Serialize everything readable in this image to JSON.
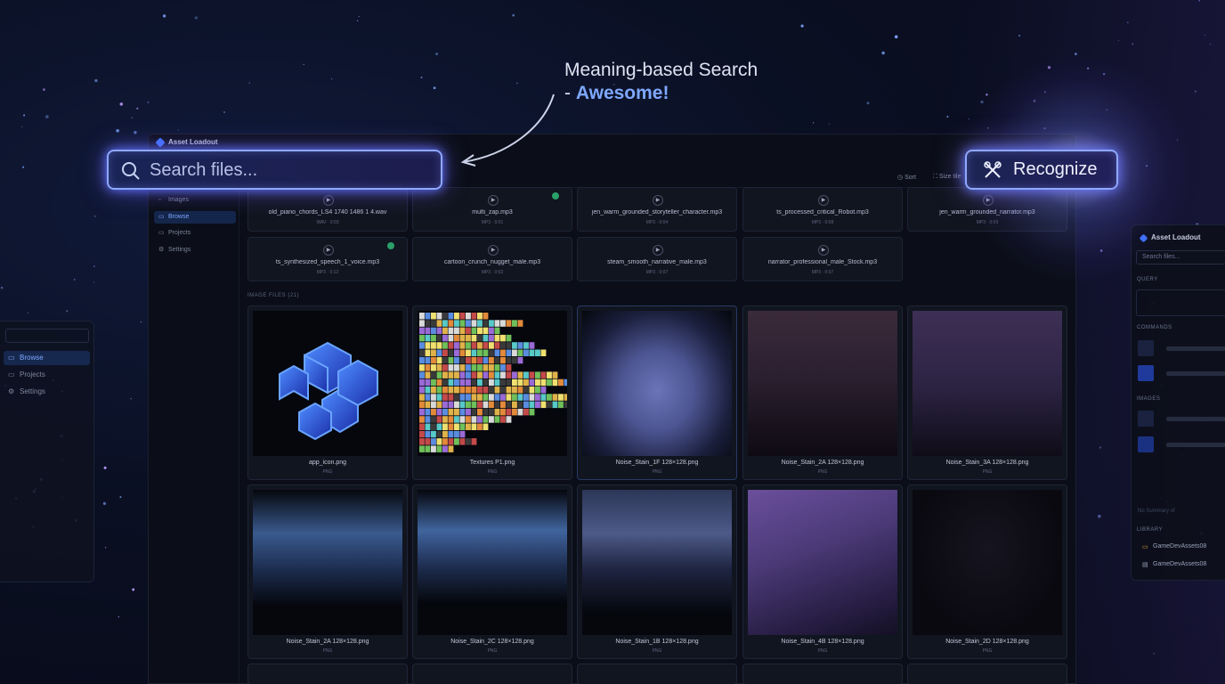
{
  "headline": {
    "line1": "Meaning-based Search",
    "prefix": "- ",
    "accent": "Awesome!"
  },
  "search": {
    "placeholder": "Search files..."
  },
  "recognize": {
    "label": "Recognize"
  },
  "window": {
    "title": "Asset Loadout",
    "toolbar": {
      "sort_label": "Sort",
      "view_label": "Size tile"
    }
  },
  "sidebar": {
    "items": [
      {
        "label": "Images"
      },
      {
        "label": "Browse"
      },
      {
        "label": "Projects"
      },
      {
        "label": "Settings"
      }
    ]
  },
  "back_window": {
    "items": [
      {
        "label": "Browse"
      },
      {
        "label": "Projects"
      },
      {
        "label": "Settings"
      }
    ]
  },
  "audio_files": [
    {
      "name": "old_piano_chords_LS4 1740 1486 1 4.wav",
      "meta": "WAV · 0:03"
    },
    {
      "name": "multi_zap.mp3",
      "meta": "MP3 · 0:01"
    },
    {
      "name": "jen_warm_grounded_storyteller_character.mp3",
      "meta": "MP3 · 0:04"
    },
    {
      "name": "ts_processed_critical_Robot.mp3",
      "meta": "MP3 · 0:08"
    },
    {
      "name": "jen_warm_grounded_narrator.mp3",
      "meta": "MP3 · 0:03"
    },
    {
      "name": "ts_synthesized_speech_1_voice.mp3",
      "meta": "MP3 · 0:12"
    },
    {
      "name": "cartoon_crunch_nugget_male.mp3",
      "meta": "MP3 · 0:02"
    },
    {
      "name": "steam_smooth_narrative_male.mp3",
      "meta": "MP3 · 0:07"
    },
    {
      "name": "narrator_professional_male_Stock.mp3",
      "meta": "MP3 · 0:07"
    }
  ],
  "section_label": "IMAGE FILES (21)",
  "image_files": [
    {
      "caption": "app_icon.png",
      "type": "PNG"
    },
    {
      "caption": "Textures P1.png",
      "type": "PNG"
    },
    {
      "caption": "Noise_Stain_1F 128×128.png",
      "type": "PNG"
    },
    {
      "caption": "Noise_Stain_2A 128×128.png",
      "type": "PNG"
    },
    {
      "caption": "Noise_Stain_3A 128×128.png",
      "type": "PNG"
    },
    {
      "caption": "Noise_Stain_2A 128×128.png",
      "type": "PNG"
    },
    {
      "caption": "Noise_Stain_2C 128×128.png",
      "type": "PNG"
    },
    {
      "caption": "Noise_Stain_1B 128×128.png",
      "type": "PNG"
    },
    {
      "caption": "Noise_Stain_4B 128×128.png",
      "type": "PNG"
    },
    {
      "caption": "Noise_Stain_2D 128×128.png",
      "type": "PNG"
    }
  ],
  "right_panel": {
    "title": "Asset Loadout",
    "search_placeholder": "Search files...",
    "section_query": "QUERY",
    "section_commands": "COMMANDS",
    "section_images": "IMAGES",
    "faint_note": "No Summary of",
    "section_library": "LIBRARY",
    "library_items": [
      {
        "label": "GameDevAssets08"
      },
      {
        "label": "GameDevAssets08"
      }
    ]
  },
  "colors": {
    "accent": "#7ea8ff",
    "glow_border": "#8fa8ff",
    "sidebar_active": "#14264a",
    "status_ok": "#2aa06a"
  }
}
